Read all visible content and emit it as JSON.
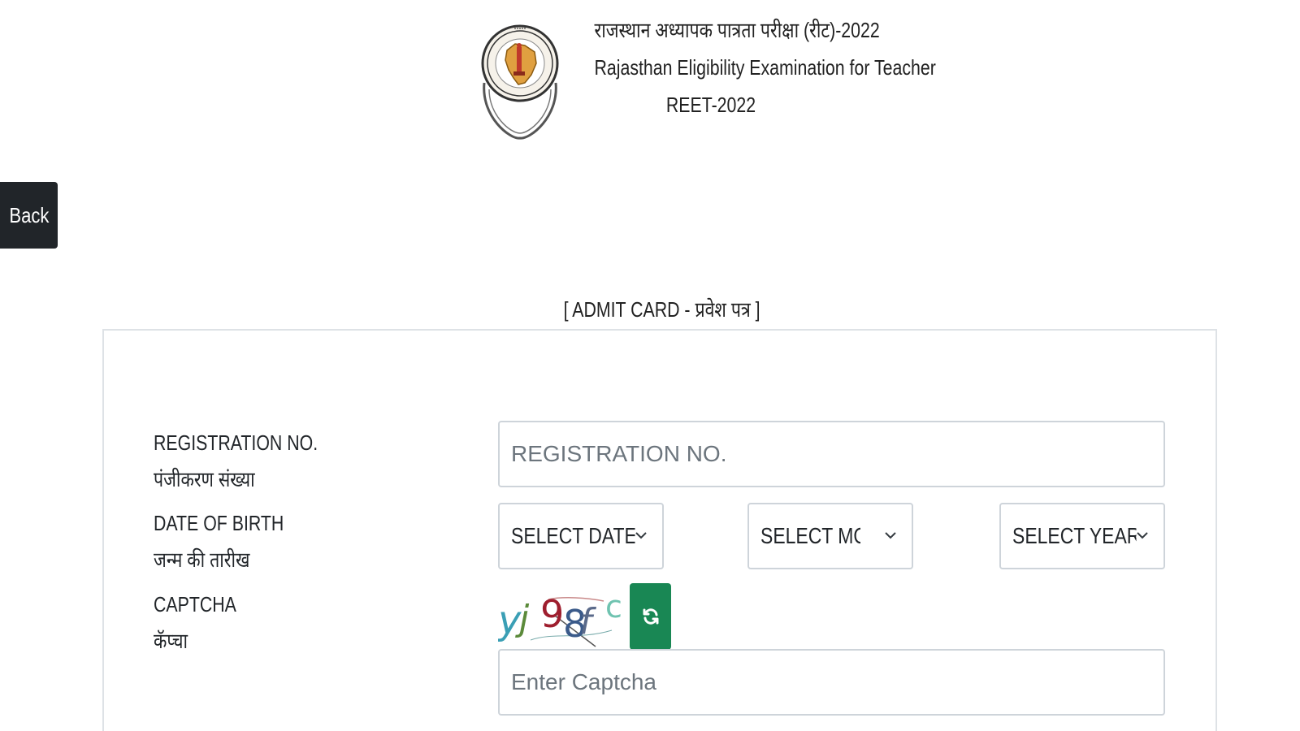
{
  "header": {
    "title_hindi": "राजस्थान अध्यापक पात्रता परीक्षा (रीट)-2022",
    "title_english": "Rajasthan Eligibility Examination for Teacher",
    "title_short": "REET-2022",
    "logo_icon": "board-seal-logo"
  },
  "back_button": {
    "label": "Back"
  },
  "section": {
    "title": "[ ADMIT CARD - प्रवेश पत्र ]"
  },
  "form": {
    "registration": {
      "label_en": "REGISTRATION NO.",
      "label_hi": "पंजीकरण संख्या",
      "placeholder": "REGISTRATION NO.",
      "value": ""
    },
    "dob": {
      "label_en": "DATE OF BIRTH",
      "label_hi": "जन्म की तारीख",
      "date_selected": "SELECT DATE",
      "month_selected": "SELECT MONTH",
      "year_selected": "SELECT YEAR"
    },
    "captcha": {
      "label_en": "CAPTCHA",
      "label_hi": "कॅप्चा",
      "image_text": "yj 98f c",
      "refresh_icon": "refresh-icon",
      "placeholder": "Enter Captcha",
      "value": ""
    }
  },
  "colors": {
    "back_button_bg": "#212529",
    "refresh_button_bg": "#198754",
    "border": "#ced4da"
  }
}
